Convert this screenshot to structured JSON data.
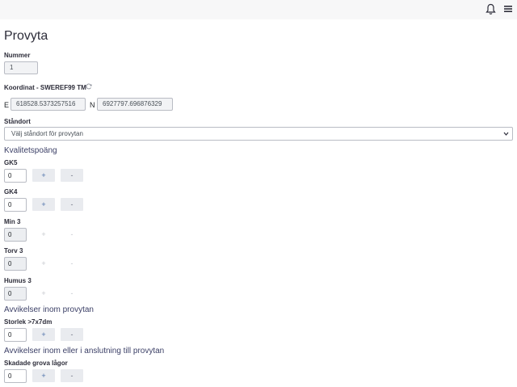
{
  "header": {
    "icons": [
      "bell-icon",
      "hamburger-menu-icon"
    ]
  },
  "page": {
    "title": "Provyta"
  },
  "nummer": {
    "label": "Nummer",
    "value": "1"
  },
  "koordinat": {
    "label": "Koordinat - SWEREF99 TM",
    "e_label": "E",
    "e_value": "618528.5373257516",
    "n_label": "N",
    "n_value": "6927797.696876329"
  },
  "standort": {
    "label": "Ståndort",
    "placeholder": "Välj ståndort för provytan"
  },
  "kvalitet": {
    "heading": "Kvalitetspoäng",
    "items": [
      {
        "label": "GK5",
        "value": "0",
        "enabled": true
      },
      {
        "label": "GK4",
        "value": "0",
        "enabled": true
      },
      {
        "label": "Min 3",
        "value": "0",
        "enabled": false
      },
      {
        "label": "Torv 3",
        "value": "0",
        "enabled": false
      },
      {
        "label": "Humus 3",
        "value": "0",
        "enabled": false
      }
    ]
  },
  "avvikelser_inom": {
    "heading": "Avvikelser inom provytan",
    "items": [
      {
        "label": "Storlek >7x7dm",
        "value": "0",
        "enabled": true
      }
    ]
  },
  "avvikelser_anslutning": {
    "heading": "Avvikelser inom eller i anslutning till provytan",
    "items": [
      {
        "label": "Skadade grova lågor",
        "value": "0",
        "enabled": true
      }
    ]
  },
  "buttons": {
    "plus": "+",
    "minus": "-"
  },
  "colors": {
    "accent": "#4a6fa8",
    "topbar": "#f7f7f8",
    "button_bg": "#e9ebef"
  }
}
